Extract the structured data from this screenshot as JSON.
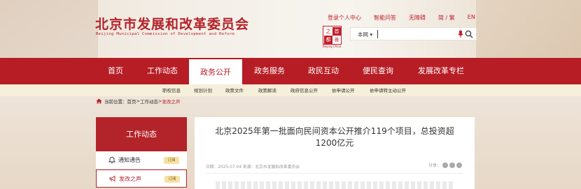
{
  "site": {
    "title_cn": "北京市发展和改革委员会",
    "title_en": "Beijing Municipal Commission of Development and Reform"
  },
  "top_links": [
    "登录个人中心",
    "智能问答",
    "无障碍",
    "简 / 繁",
    "EN"
  ],
  "seal": {
    "chars": [
      "首",
      "善",
      "之",
      "都"
    ],
    "caption": "Beijing China"
  },
  "search": {
    "scope": "本网 ▾",
    "value": "",
    "placeholder": ""
  },
  "nav": {
    "items": [
      "首页",
      "工作动态",
      "政务公开",
      "政务服务",
      "政民互动",
      "便民查询",
      "发展改革专栏"
    ],
    "active_index": 2
  },
  "subnav": {
    "items": [
      "职权信息",
      "规划计划",
      "政策文件",
      "政策解读",
      "政府信息公开",
      "依申请公开",
      "依申请转主动公开"
    ]
  },
  "breadcrumb": {
    "label": "当前位置：",
    "items": [
      "首页",
      "工作动态",
      "发改之声"
    ],
    "sep": " > "
  },
  "sidebar": {
    "header": "工作动态",
    "items": [
      {
        "label": "通知通告",
        "tag": "订阅",
        "icon": "bell-icon"
      },
      {
        "label": "发改之声",
        "tag": "订阅",
        "icon": "megaphone-icon"
      }
    ]
  },
  "article": {
    "title": "北京2025年第一批面向民间资本公开推介119个项目，总投资超1200亿元",
    "meta": "日期：2025-07-04   来源：北京市发展和改革委员会",
    "share_label": "分享："
  },
  "colors": {
    "brand": "#b71d25",
    "sub_nav_bg": "#f6efd9",
    "tag_bg": "#f7e1a2"
  }
}
